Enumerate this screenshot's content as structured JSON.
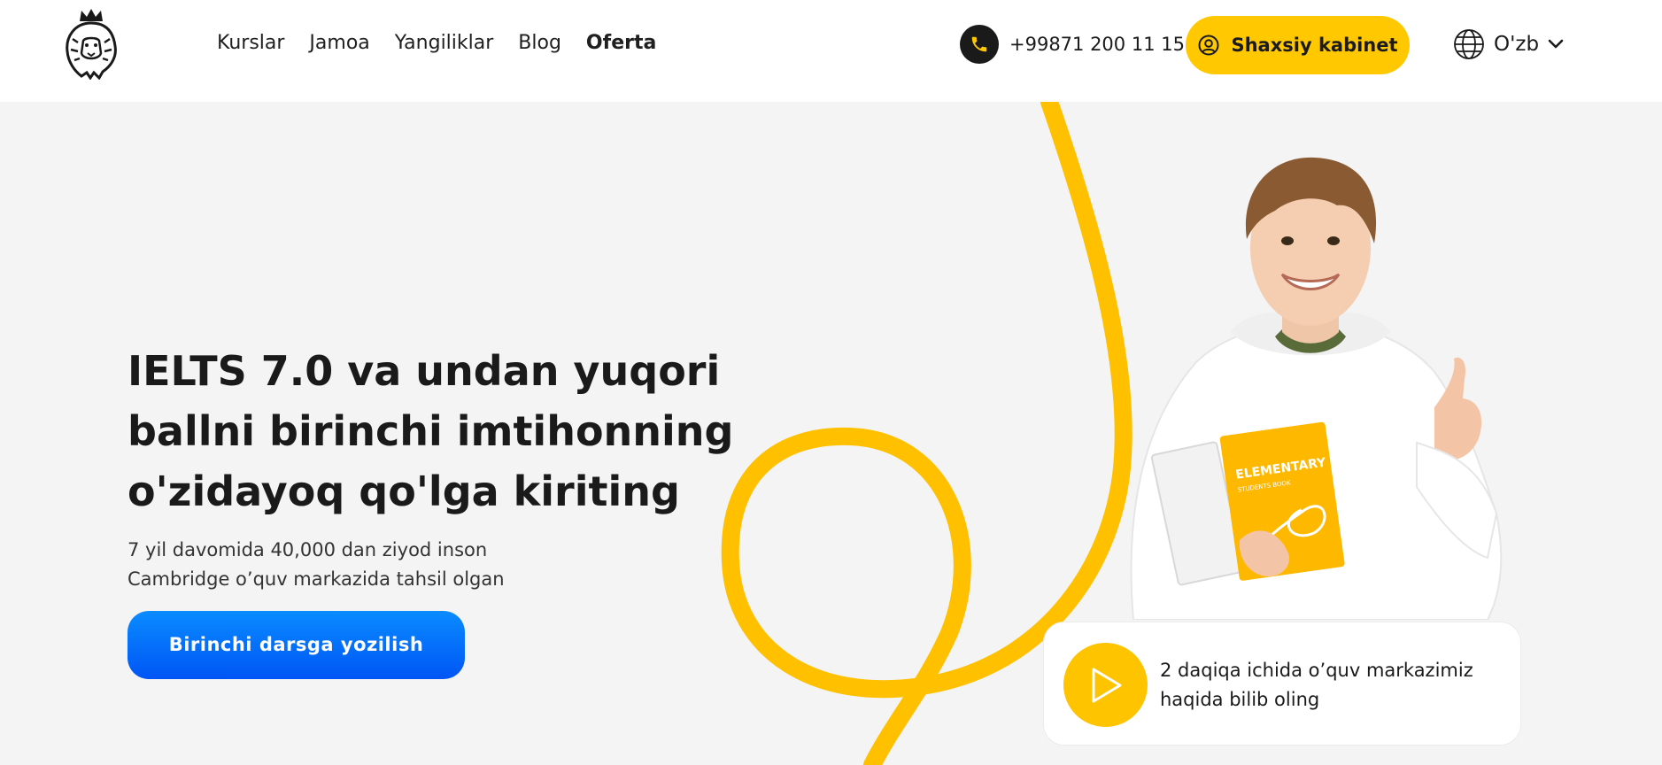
{
  "header": {
    "nav": [
      {
        "label": "Kurslar"
      },
      {
        "label": "Jamoa"
      },
      {
        "label": "Yangiliklar"
      },
      {
        "label": "Blog"
      },
      {
        "label": "Oferta"
      }
    ],
    "phone": "+99871 200 11 15",
    "cabinet_label": "Shaxsiy kabinet",
    "language": "O'zb"
  },
  "hero": {
    "headline_bold": "IELTS 7.0 va undan yuqori ballni",
    "headline_rest": " birinchi imtihonning o'zidayoq qo'lga kiriting",
    "sub_line1": "7 yil davomida 40,000 dan ziyod inson",
    "sub_line2": "Cambridge o’quv markazida tahsil olgan",
    "cta_label": "Birinchi darsga yozilish",
    "book_title": "ELEMENTARY",
    "book_subtitle": "STUDENTS BOOK"
  },
  "video": {
    "text": "2 daqiqa ichida o’quv markazimiz haqida bilib oling"
  },
  "colors": {
    "accent_yellow": "#ffc800",
    "cta_blue": "#0066ff",
    "dark": "#1a1a1a",
    "background": "#f4f4f4"
  },
  "icons": {
    "logo": "lion-crown-icon",
    "phone": "phone-icon",
    "user": "user-circle-icon",
    "globe": "globe-icon",
    "chevron": "chevron-down-icon",
    "play": "play-icon"
  }
}
